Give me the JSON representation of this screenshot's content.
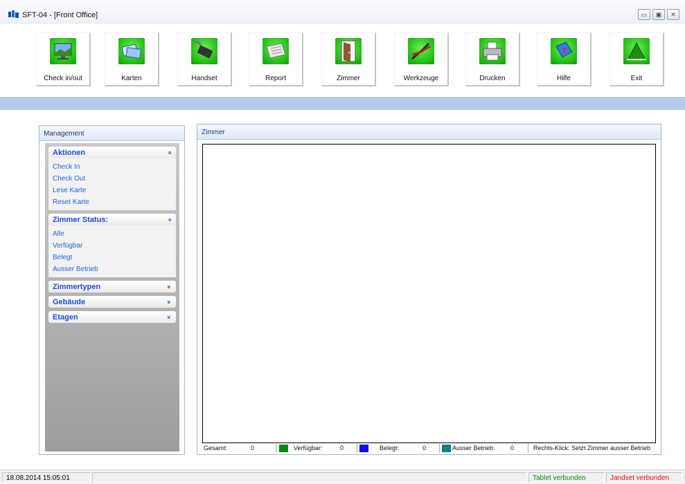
{
  "window": {
    "title": "SFT-04 - [Front Office]",
    "controls": {
      "minimize": "▭",
      "maximize": "▣",
      "close": "✕"
    }
  },
  "toolbar": {
    "buttons": [
      {
        "label": "Check in/out",
        "icon": "monitor-icon"
      },
      {
        "label": "Karten",
        "icon": "cards-icon"
      },
      {
        "label": "Handset",
        "icon": "handset-icon"
      },
      {
        "label": "Report",
        "icon": "report-icon"
      },
      {
        "label": "Zimmer",
        "icon": "door-icon"
      },
      {
        "label": "Werkzeuge",
        "icon": "pliers-icon"
      },
      {
        "label": "Drucken",
        "icon": "printer-icon"
      },
      {
        "label": "Hilfe",
        "icon": "help-book-icon"
      },
      {
        "label": "Exit",
        "icon": "exit-icon"
      }
    ]
  },
  "management": {
    "title": "Management",
    "groups": [
      {
        "title": "Aktionen",
        "items": [
          "Check In",
          "Check Out",
          "Lese Karte",
          "Reset Karte"
        ]
      },
      {
        "title": "Zimmer Status:",
        "items": [
          "Alle",
          "Verfügbar",
          "Belegt",
          "Ausser Betrieb"
        ]
      },
      {
        "title": "Zimmertypen"
      },
      {
        "title": "Gebäude"
      },
      {
        "title": "Etagen"
      }
    ],
    "chev_up": "»",
    "chev_down": "»"
  },
  "zimmer": {
    "title": "Zimmer",
    "status": {
      "gesamt_label": "Gesamt:",
      "gesamt_value": "0",
      "verfuegbar_label": "Verfügbar:",
      "verfuegbar_value": "0",
      "belegt_label": "Belegt:",
      "belegt_value": "0",
      "ausser_label": "Ausser Betrieb:",
      "ausser_value": "0",
      "hint": "Rechts-Klick: Setzt Zimmer ausser Betrieb",
      "colors": {
        "verfuegbar": "#0a8a0a",
        "belegt": "#1010e0",
        "ausser": "#108080"
      }
    }
  },
  "statusbar": {
    "datetime": "18.08.2014 15:05:01",
    "tablet": "Tablet verbunden",
    "handset": "Jandset verbunden",
    "colors": {
      "tablet": "#0a8a0a",
      "handset": "#e01010"
    }
  }
}
